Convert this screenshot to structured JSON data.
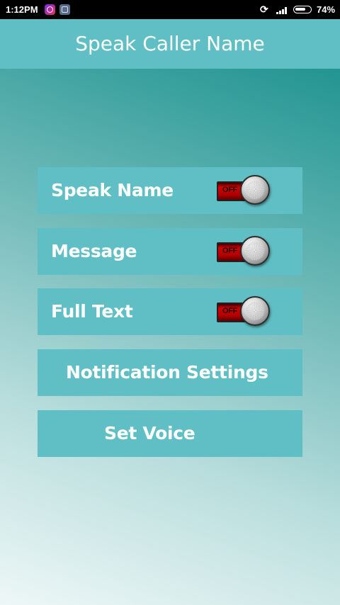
{
  "status_bar": {
    "time": "1:12PM",
    "battery_percent": "74%",
    "battery_level": 0.74,
    "icons": [
      "app-notification-icon",
      "app-notification-icon-2",
      "sync-off-icon",
      "signal-icon",
      "battery-icon"
    ]
  },
  "header": {
    "title": "Speak Caller Name"
  },
  "settings": [
    {
      "label": "Speak Name",
      "toggle_state": "OFF"
    },
    {
      "label": "Message",
      "toggle_state": "OFF"
    },
    {
      "label": "Full Text",
      "toggle_state": "OFF"
    }
  ],
  "buttons": {
    "notification_settings": "Notification Settings",
    "set_voice": "Set Voice"
  },
  "colors": {
    "header": "#5fbfc4",
    "row": "#5fbfc4",
    "text": "#ffffff",
    "toggle_off": "#d40000"
  }
}
